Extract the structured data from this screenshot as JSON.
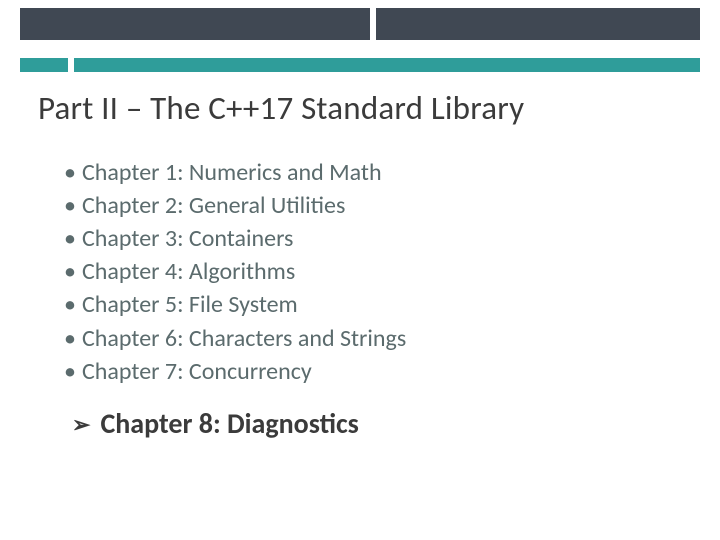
{
  "title": "Part II – The C++17 Standard Library",
  "chapters": [
    "Chapter 1: Numerics and Math",
    "Chapter 2: General Utilities",
    "Chapter 3: Containers",
    "Chapter 4: Algorithms",
    "Chapter 5: File System",
    "Chapter 6: Characters and Strings",
    "Chapter 7: Concurrency"
  ],
  "highlight": "Chapter 8: Diagnostics",
  "arrow_glyph": "➢"
}
